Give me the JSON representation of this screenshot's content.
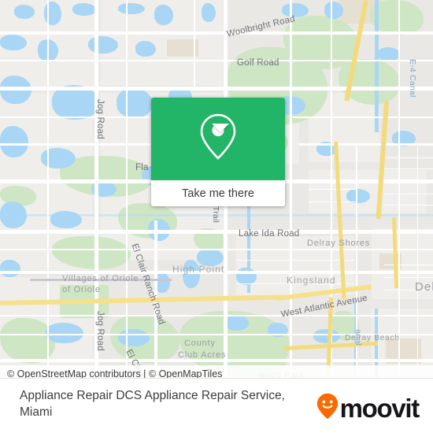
{
  "map": {
    "attribution": "© OpenStreetMap contributors | © OpenMapTiles",
    "base_color": "#e9e8e4",
    "water_color": "#a9d6f5",
    "park_color": "#cfe6c4",
    "road_color": "#ffffff",
    "highway_color": "#f7e08a",
    "road_labels": [
      {
        "id": "woolbright",
        "text": "Woolbright Road"
      },
      {
        "id": "golf",
        "text": "Golf Road"
      },
      {
        "id": "jog-top",
        "text": "Jog Road"
      },
      {
        "id": "jog-bottom",
        "text": "Jog Road"
      },
      {
        "id": "el-clair-mid",
        "text": "El Clair Ranch Road"
      },
      {
        "id": "el-clair-low",
        "text": "El Clair Ranch Road"
      },
      {
        "id": "lake-ida",
        "text": "Lake Ida Road"
      },
      {
        "id": "west-atlantic",
        "text": "West Atlantic Avenue"
      },
      {
        "id": "flavor",
        "text": "Fla"
      },
      {
        "id": "trail",
        "text": "Trail"
      }
    ],
    "place_labels": [
      {
        "id": "villages-of-oriole",
        "text": "Villages of Oriole"
      },
      {
        "id": "high-point",
        "text": "High Point"
      },
      {
        "id": "kingsland",
        "text": "Kingsland"
      },
      {
        "id": "delray-shores",
        "text": "Delray Shores"
      },
      {
        "id": "delray-beach",
        "text": "Delray Beach"
      },
      {
        "id": "delray-edge",
        "text": "Delr"
      },
      {
        "id": "county-club-acres-1",
        "text": "County"
      },
      {
        "id": "county-club-acres-2",
        "text": "Club Acres"
      },
      {
        "id": "wood-park",
        "text": "wood Park"
      }
    ],
    "water_labels": [
      {
        "id": "e4-canal",
        "text": "E-4 Canal"
      },
      {
        "id": "canal-right",
        "text": "anal"
      }
    ]
  },
  "popup": {
    "header_color": "#22b567",
    "pin_icon": "map-pin-icon",
    "action_label": "Take me there"
  },
  "footer": {
    "caption": "Appliance Repair DCS Appliance Repair Service, Miami",
    "brand_name": "moovit",
    "brand_icon": "moovit-smiley-pin-icon",
    "brand_icon_color": "#f96a00",
    "brand_text_color": "#16161a"
  }
}
